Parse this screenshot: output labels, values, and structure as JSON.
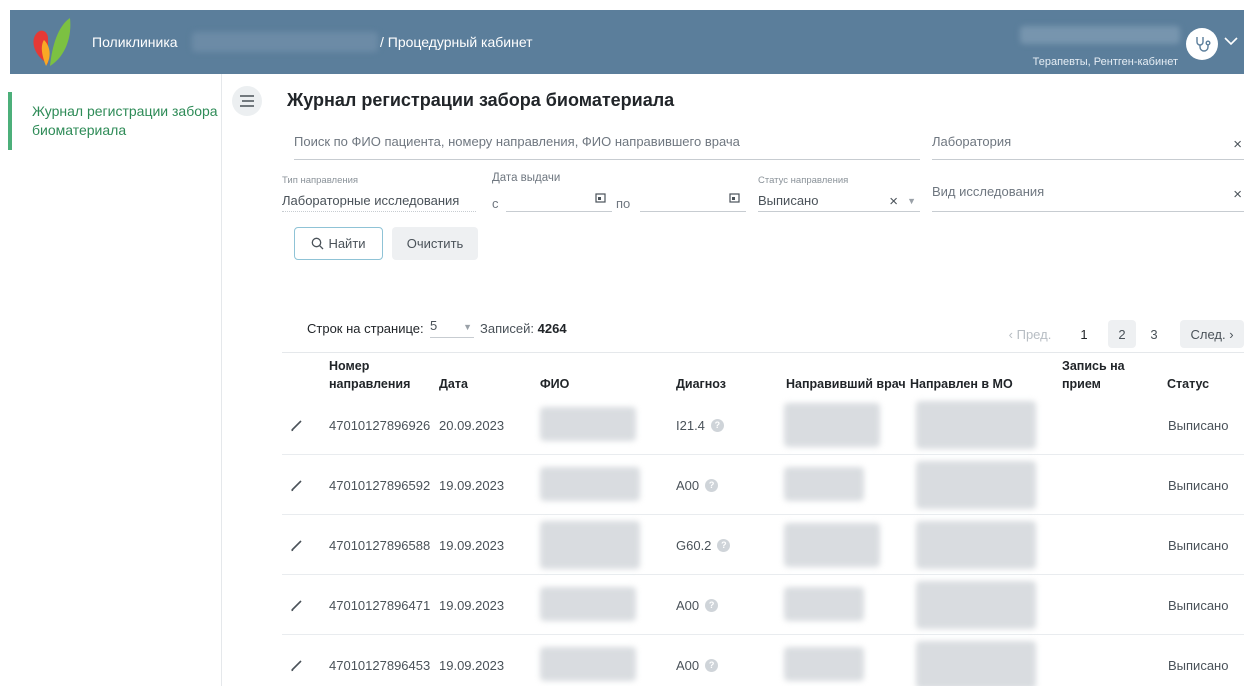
{
  "header": {
    "app_name": "Поликлиника",
    "cabinet": "/ Процедурный кабинет",
    "user_role": "Терапевты, Рентген-кабинет",
    "color": "#5b7e9b"
  },
  "sidebar": {
    "items": [
      {
        "label": "Журнал регистрации забора биоматериала",
        "active": true
      }
    ],
    "accent": "#4caf7a"
  },
  "page": {
    "title": "Журнал регистрации забора биоматериала"
  },
  "filters": {
    "search_placeholder": "Поиск по ФИО пациента, номеру направления, ФИО направившего врача",
    "lab_placeholder": "Лаборатория",
    "type_label": "Тип направления",
    "type_value": "Лабораторные исследования",
    "date_label": "Дата выдачи",
    "date_from": "с",
    "date_to": "по",
    "status_label": "Статус направления",
    "status_value": "Выписано",
    "study_placeholder": "Вид исследования",
    "find_button": "Найти",
    "clear_button": "Очистить"
  },
  "toolbar": {
    "rows_label": "Строк на странице:",
    "rows_value": "5",
    "records_label": "Записей:",
    "records_value": "4264"
  },
  "pagination": {
    "prev": "‹ Пред.",
    "pages": [
      "1",
      "2",
      "3"
    ],
    "next": "След. ›"
  },
  "table": {
    "columns": {
      "num_line1": "Номер",
      "num_line2": "направления",
      "date": "Дата",
      "fio": "ФИО",
      "diag": "Диагноз",
      "doctor": "Направивший врач",
      "mo": "Направлен в МО",
      "appt_line1": "Запись на",
      "appt_line2": "прием",
      "status": "Статус"
    },
    "rows": [
      {
        "num": "47010127896926",
        "date": "20.09.2023",
        "diag": "I21.4",
        "status": "Выписано"
      },
      {
        "num": "47010127896592",
        "date": "19.09.2023",
        "diag": "A00",
        "status": "Выписано"
      },
      {
        "num": "47010127896588",
        "date": "19.09.2023",
        "diag": "G60.2",
        "status": "Выписано"
      },
      {
        "num": "47010127896471",
        "date": "19.09.2023",
        "diag": "A00",
        "status": "Выписано"
      },
      {
        "num": "47010127896453",
        "date": "19.09.2023",
        "diag": "A00",
        "status": "Выписано"
      }
    ]
  }
}
